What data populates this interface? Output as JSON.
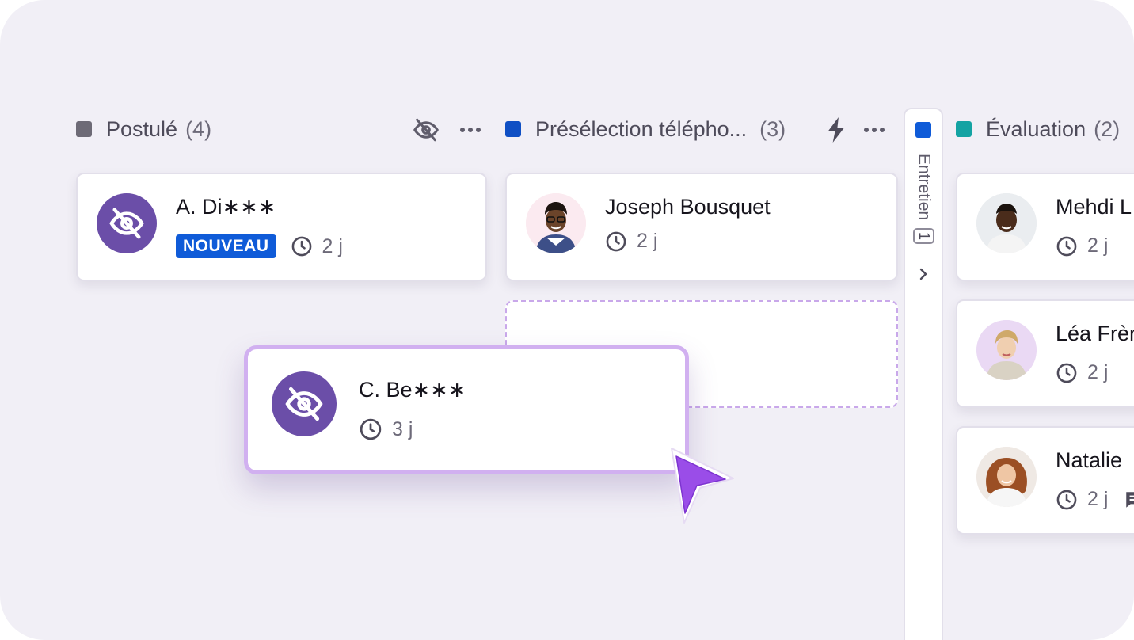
{
  "columns": [
    {
      "name": "Postulé",
      "count": "(4)",
      "color": "#6d6a76"
    },
    {
      "name": "Présélection télépho...",
      "count": "(3)",
      "color": "#0f4fc4"
    },
    {
      "name": "Entretien",
      "count": "1",
      "color": "#0f5bd8",
      "collapsed": true
    },
    {
      "name": "Évaluation",
      "count": "(2)",
      "color": "#14a3a3"
    }
  ],
  "cards": {
    "postule_1": {
      "name": "A. Di∗∗∗",
      "badge": "NOUVEAU",
      "age": "2 j"
    },
    "preselection_1": {
      "name": "Joseph Bousquet",
      "age": "2 j"
    },
    "evaluation_1": {
      "name": "Mehdi L",
      "age": "2 j"
    },
    "evaluation_2": {
      "name": "Léa Frèr",
      "age": "2 j"
    },
    "evaluation_3": {
      "name": "Natalie",
      "age": "2 j"
    }
  },
  "dragging_card": {
    "name": "C. Be∗∗∗",
    "age": "3 j"
  },
  "icons": [
    "eye-off-icon",
    "more-icon",
    "lightning-icon",
    "clock-icon",
    "chevron-right-icon",
    "comment-icon",
    "cursor-icon"
  ]
}
